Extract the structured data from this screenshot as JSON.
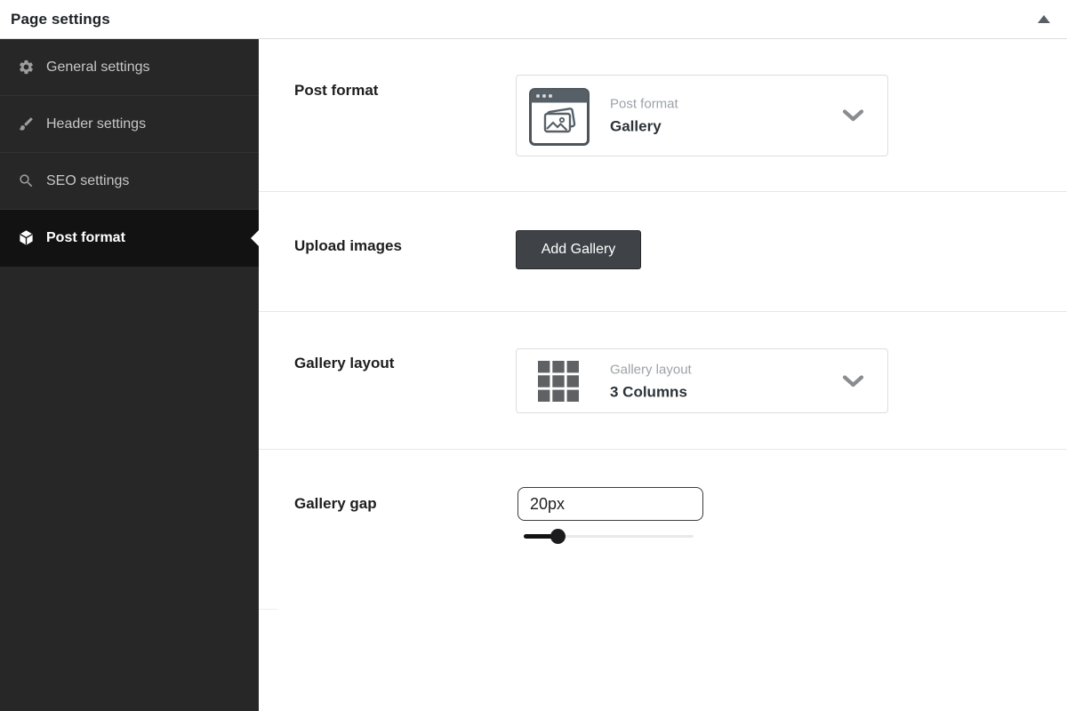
{
  "header": {
    "title": "Page settings",
    "collapse_icon": "triangle-up"
  },
  "sidebar": {
    "items": [
      {
        "label": "General settings",
        "icon": "gear-icon",
        "active": false
      },
      {
        "label": "Header settings",
        "icon": "brush-icon",
        "active": false
      },
      {
        "label": "SEO settings",
        "icon": "search-icon",
        "active": false
      },
      {
        "label": "Post format",
        "icon": "cube-icon",
        "active": true
      }
    ]
  },
  "content": {
    "rows": [
      {
        "label": "Post format",
        "control": {
          "type": "select",
          "icon": "browser-gallery-icon",
          "placeholder": "Post format",
          "value": "Gallery"
        }
      },
      {
        "label": "Upload images",
        "control": {
          "type": "button",
          "label": "Add Gallery"
        }
      },
      {
        "label": "Gallery layout",
        "control": {
          "type": "select",
          "icon": "grid-3x3-icon",
          "placeholder": "Gallery layout",
          "value": "3 Columns"
        }
      },
      {
        "label": "Gallery gap",
        "control": {
          "type": "text-with-slider",
          "value": "20px",
          "slider_percent": 20
        }
      }
    ]
  },
  "colors": {
    "sidebar_bg": "#272727",
    "sidebar_active_bg": "#121212",
    "sidebar_text": "#c7c7c7",
    "button_bg": "#3f4347",
    "separator": "#e8e8e8",
    "placeholder_text": "#9da1a6",
    "value_text": "#2c3338",
    "slider_fill": "#131313"
  }
}
